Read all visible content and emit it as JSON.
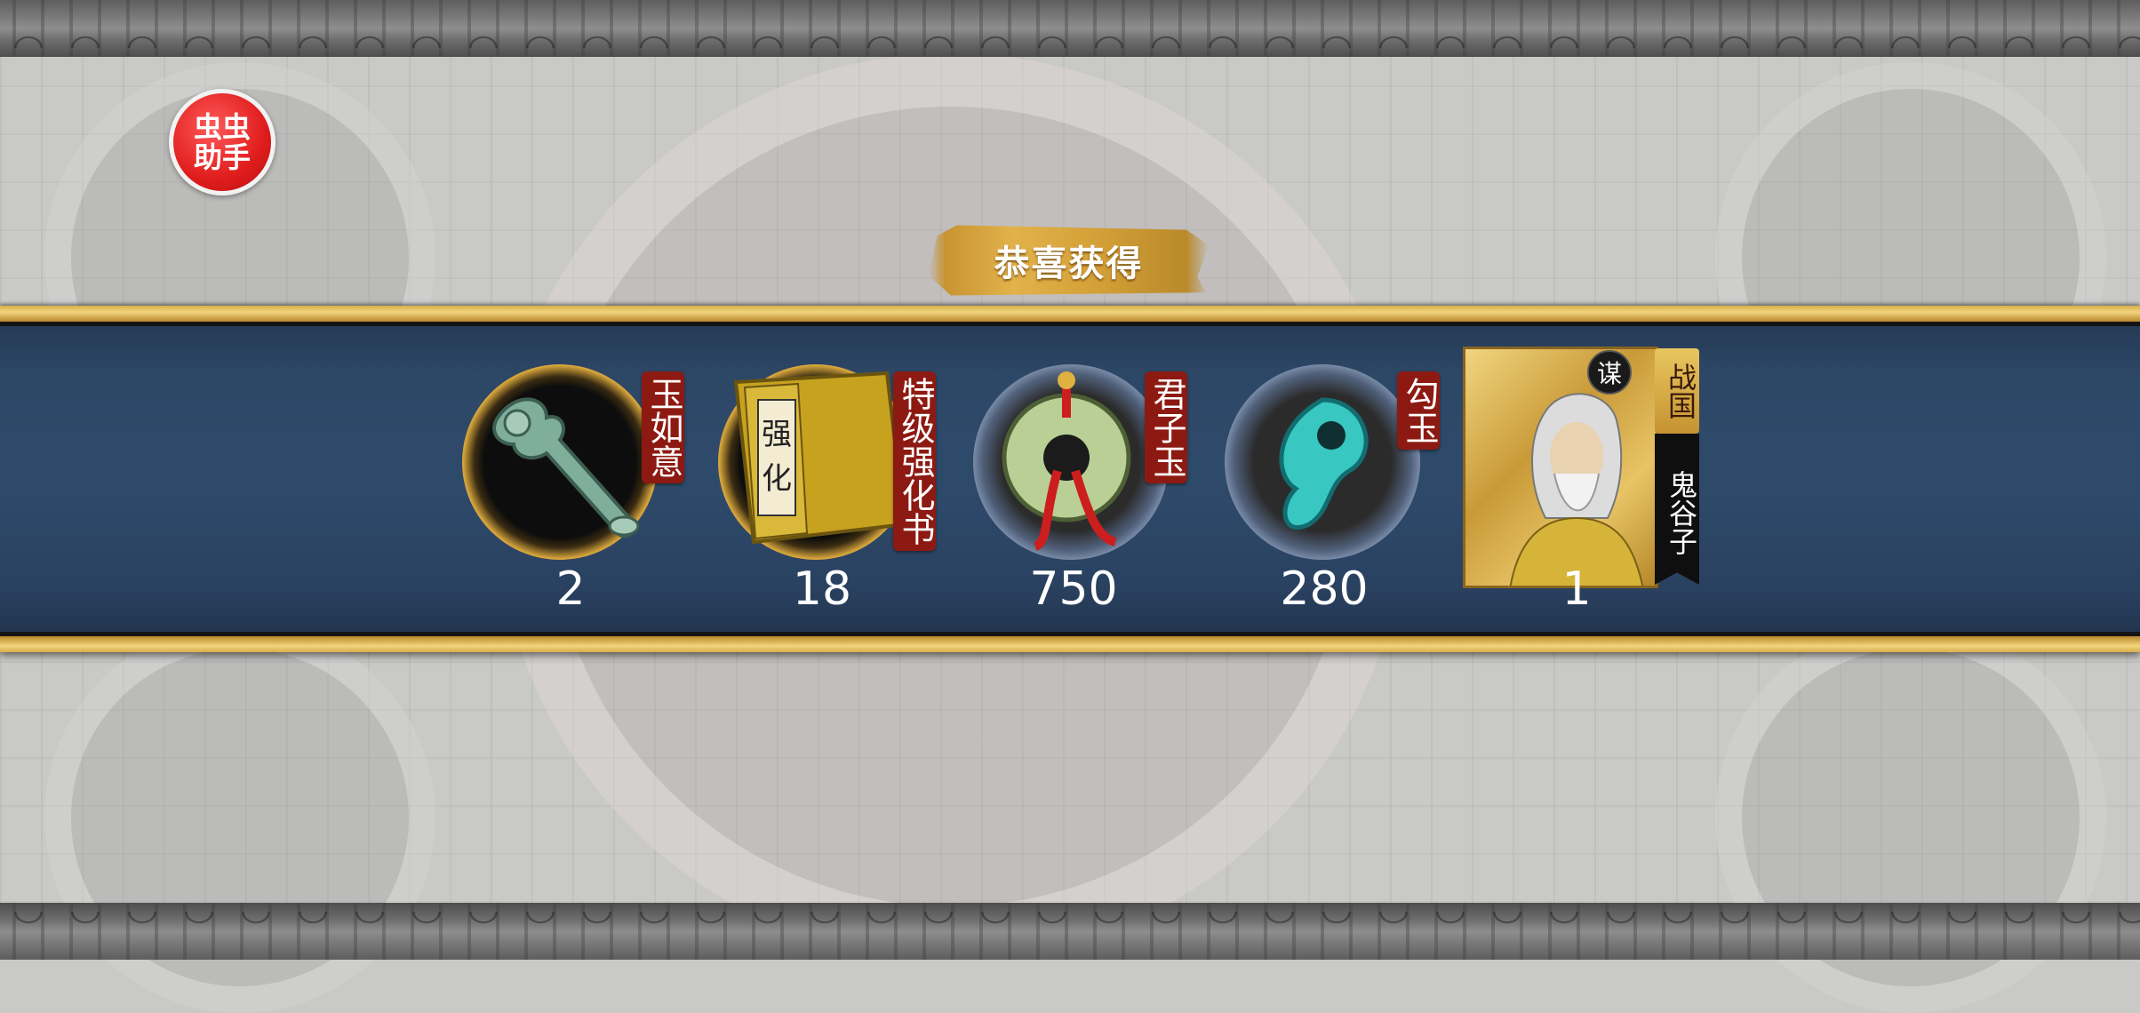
{
  "helper_badge": {
    "label": "虫虫\n助手"
  },
  "popup": {
    "title": "恭喜获得"
  },
  "rewards": [
    {
      "name": "玉如意",
      "quantity": "2",
      "icon": "jade-ruyi-icon"
    },
    {
      "name": "特级强化书",
      "quantity": "18",
      "icon": "enhancement-book-icon"
    },
    {
      "name": "君子玉",
      "quantity": "750",
      "icon": "junzi-jade-icon"
    },
    {
      "name": "勾玉",
      "quantity": "280",
      "icon": "magatama-icon"
    }
  ],
  "hero": {
    "badge": "谋",
    "faction": "战国",
    "name": "鬼谷子",
    "quantity": "1"
  },
  "colors": {
    "band": "#2e4a6b",
    "gold": "#e2b24a",
    "label_red": "#8d1a12",
    "badge_red": "#e01d1d"
  }
}
